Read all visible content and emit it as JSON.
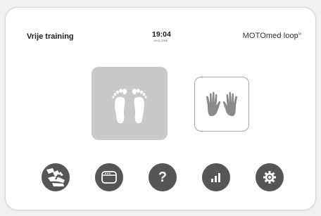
{
  "header": {
    "title": "Vrije training",
    "time": "19:04",
    "date": "19.01.2006",
    "brand": "MOTOmed loop",
    "brand_sup": "la"
  },
  "modes": [
    {
      "name": "legs",
      "icon": "feet-icon",
      "selected": true
    },
    {
      "name": "arms",
      "icon": "hands-icon",
      "selected": false
    }
  ],
  "bottom_buttons": [
    {
      "icon": "exercise-program-icon"
    },
    {
      "icon": "display-window-icon"
    },
    {
      "icon": "help-icon",
      "glyph": "?"
    },
    {
      "icon": "statistics-icon"
    },
    {
      "icon": "settings-gear-icon"
    }
  ],
  "colors": {
    "button": "#555555",
    "selected_tile": "#c9c9c9",
    "tile_border": "#aaaaaa"
  }
}
